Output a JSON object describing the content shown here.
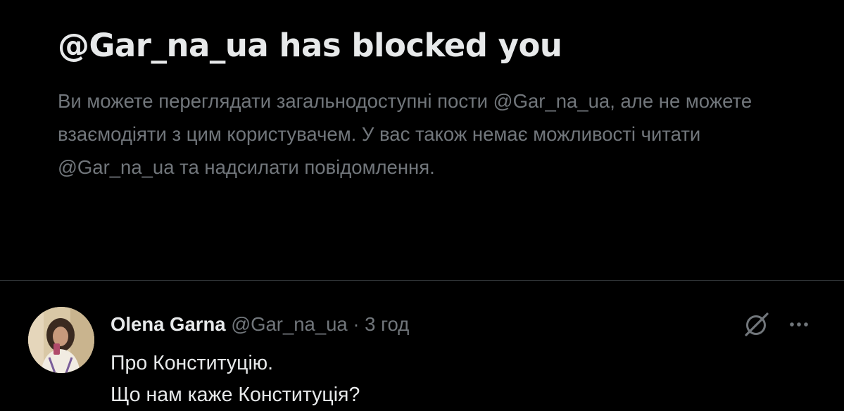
{
  "blocked": {
    "title": "@Gar_na_ua has blocked you",
    "description": "Ви можете переглядати загальнодоступні пости @Gar_na_ua, але не можете взаємодіяти з цим користувачем. У вас також немає можливості читати @Gar_na_ua та надсилати повідомлення."
  },
  "tweet": {
    "display_name": "Olena Garna",
    "handle": "@Gar_na_ua",
    "separator": "·",
    "time": "3 год",
    "lines": [
      "Про Конституцію.",
      "Що нам каже Конституція?"
    ],
    "icons": {
      "grok": "grok-icon",
      "more": "more-icon",
      "avatar": "avatar"
    }
  },
  "colors": {
    "background": "#000000",
    "primary_text": "#e7e9ea",
    "secondary_text": "#71767b",
    "divider": "#2f3336"
  }
}
